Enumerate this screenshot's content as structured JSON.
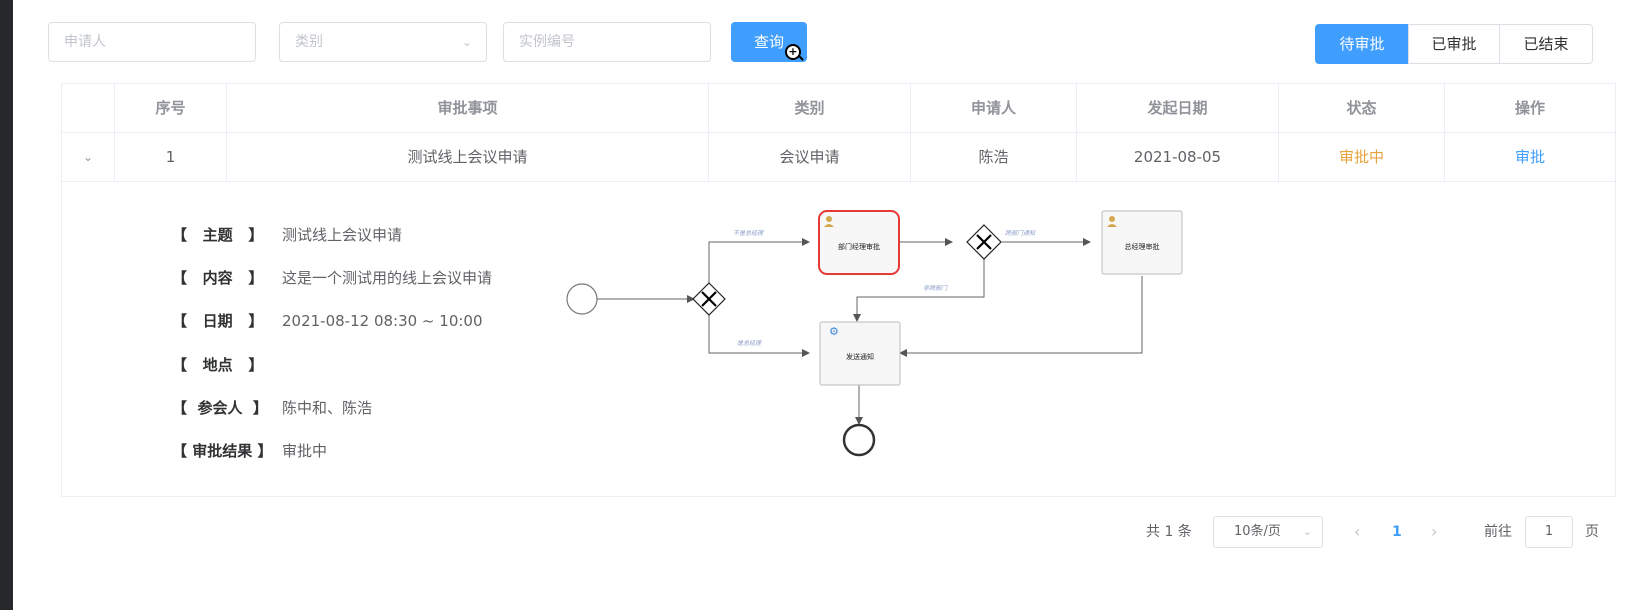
{
  "filters": {
    "applicant_placeholder": "申请人",
    "category_placeholder": "类别",
    "instance_placeholder": "实例编号",
    "query_label": "查询"
  },
  "tabs": [
    {
      "label": "待审批",
      "active": true
    },
    {
      "label": "已审批",
      "active": false
    },
    {
      "label": "已结束",
      "active": false
    }
  ],
  "table": {
    "columns": [
      "序号",
      "审批事项",
      "类别",
      "申请人",
      "发起日期",
      "状态",
      "操作"
    ],
    "rows": [
      {
        "index": "1",
        "item": "测试线上会议申请",
        "category": "会议申请",
        "applicant": "陈浩",
        "date": "2021-08-05",
        "status": "审批中",
        "action": "审批"
      }
    ]
  },
  "detail": {
    "subject_label": "【   主题   】",
    "subject": "测试线上会议申请",
    "content_label": "【   内容   】",
    "content": "这是一个测试用的线上会议申请",
    "date_label": "【   日期   】",
    "date": "2021-08-12   08:30 ~ 10:00",
    "place_label": "【   地点   】",
    "place": "",
    "attendees_label": "【  参会人  】",
    "attendees": "陈中和、陈浩",
    "result_label": "【 审批结果 】",
    "result": "审批中"
  },
  "flow": {
    "task_dept": "部门经理审批",
    "task_gm": "总经理审批",
    "task_notify": "发送通知",
    "edge_not_gm": "不是总经理",
    "edge_is_gm": "是总经理",
    "edge_cross_dept": "跨部门通知",
    "edge_not_cross": "非跨部门"
  },
  "pagination": {
    "total": "共 1 条",
    "page_size": "10条/页",
    "current": "1",
    "goto_label": "前往",
    "goto_value": "1",
    "page_unit": "页"
  },
  "colors": {
    "primary": "#409eff",
    "status_pending": "#e6a23c",
    "highlight_border": "#e53935"
  }
}
